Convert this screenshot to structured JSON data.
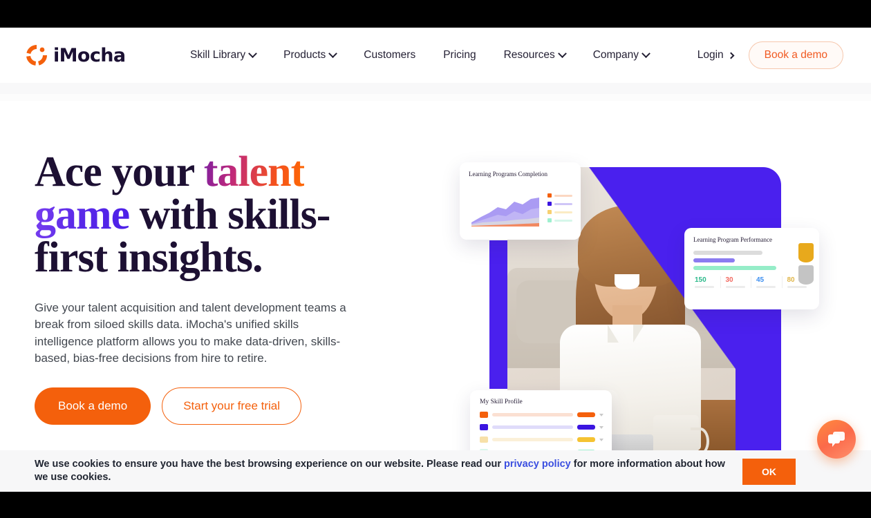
{
  "brand": {
    "name": "iMocha",
    "logo_icon": "imocha-ring-logo",
    "accent": "#f4600c"
  },
  "header": {
    "nav": [
      {
        "label": "Skill Library",
        "has_dropdown": true
      },
      {
        "label": "Products",
        "has_dropdown": true
      },
      {
        "label": "Customers",
        "has_dropdown": false
      },
      {
        "label": "Pricing",
        "has_dropdown": false
      },
      {
        "label": "Resources",
        "has_dropdown": true
      },
      {
        "label": "Company",
        "has_dropdown": true
      }
    ],
    "login_label": "Login",
    "demo_label": "Book a demo"
  },
  "hero": {
    "headline": {
      "part1": "Ace your ",
      "talent": "talent",
      "part2": " ",
      "game": "game",
      "part3": " with skills-first insights."
    },
    "subtext": "Give your talent acquisition and talent development teams a break from siloed skills data. iMocha's unified skills intelligence platform allows you to make data-driven, skills-based, bias-free decisions from hire to retire.",
    "primary_cta": "Book a demo",
    "secondary_cta": "Start your free trial"
  },
  "cards": {
    "completion": {
      "title": "Learning Programs Completion",
      "legend": [
        {
          "color": "#f4600c",
          "line": "#fbd7c2"
        },
        {
          "color": "#3b15e0",
          "line": "#cfc6f7"
        },
        {
          "color": "#f7d070",
          "line": "#fbecc4"
        },
        {
          "color": "#9ef0cf",
          "line": "#d6f7ea"
        }
      ],
      "chart_colors": {
        "area_purple": "#8e79ef",
        "area_light": "#c9c0f5",
        "area_gray": "#d9d9de",
        "area_orange": "#f47a4a"
      }
    },
    "performance": {
      "title": "Learning Program Performance",
      "bars": [
        {
          "color": "#dcdcdc",
          "width": "58%"
        },
        {
          "color": "#8b7bf0",
          "width": "35%"
        },
        {
          "color": "#95edc8",
          "width": "70%"
        }
      ],
      "stats": [
        {
          "value": "150",
          "color": "#2bb98a"
        },
        {
          "value": "30",
          "color": "#f2685f"
        },
        {
          "value": "45",
          "color": "#3b8ef0"
        },
        {
          "value": "80",
          "color": "#e0b64a"
        }
      ],
      "shields": [
        {
          "color": "#e8a91c"
        },
        {
          "color": "#c4c4c4"
        }
      ]
    },
    "skill_profile": {
      "title": "My Skill Profile",
      "rows": [
        {
          "chip": "#f4600c",
          "track": "#fbe0d2",
          "pill": "#f4600c"
        },
        {
          "chip": "#3b15e0",
          "track": "#e0dcfa",
          "pill": "#3b15e0"
        },
        {
          "chip": "#f7e0a8",
          "track": "#fbf0d8",
          "pill": "#f5c332"
        },
        {
          "chip": "#d9f7ea",
          "track": "#e6faf2",
          "pill": "#9ef0cf"
        }
      ]
    }
  },
  "cookie": {
    "text_before": "We use cookies to ensure you have the best browsing experience on our website. Please read our ",
    "link_label": "privacy policy",
    "text_after": " for more information about how we use cookies.",
    "ok_label": "OK"
  },
  "chat": {
    "icon": "chat-bubble-icon"
  }
}
